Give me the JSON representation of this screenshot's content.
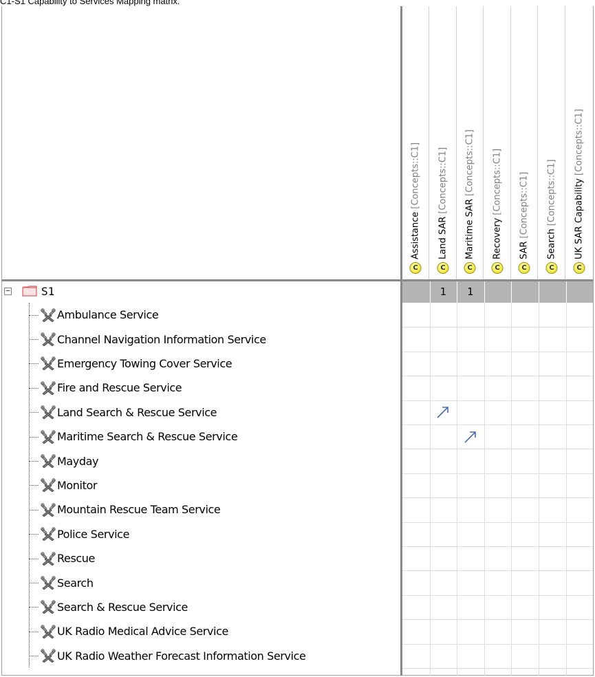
{
  "caption": "C1-S1 Capability to Services Mapping matrix.",
  "columns": [
    {
      "name": "Assistance",
      "tag": "[Concepts::C1]"
    },
    {
      "name": "Land SAR",
      "tag": "[Concepts::C1]"
    },
    {
      "name": "Maritime SAR",
      "tag": "[Concepts::C1]"
    },
    {
      "name": "Recovery",
      "tag": "[Concepts::C1]"
    },
    {
      "name": "SAR",
      "tag": "[Concepts::C1]"
    },
    {
      "name": "Search",
      "tag": "[Concepts::C1]"
    },
    {
      "name": "UK SAR Capability",
      "tag": "[Concepts::C1]"
    }
  ],
  "column_icon_letter": "C",
  "root": {
    "expander": "−",
    "label": "S1",
    "counts": [
      "",
      "1",
      "1",
      "",
      "",
      "",
      ""
    ]
  },
  "services": [
    "Ambulance Service",
    "Channel Navigation Information Service",
    "Emergency Towing Cover Service",
    "Fire and Rescue Service",
    "Land Search & Rescue Service",
    "Maritime Search & Rescue Service",
    "Mayday",
    "Monitor",
    "Mountain Rescue Team Service",
    "Police Service",
    "Rescue",
    "Search",
    "Search & Rescue Service",
    "UK Radio Medical Advice Service",
    "UK Radio Weather Forecast Information Service"
  ],
  "dependencies": [
    {
      "service": "Land Search & Rescue Service",
      "column": "Land SAR"
    },
    {
      "service": "Maritime Search & Rescue Service",
      "column": "Maritime SAR"
    }
  ],
  "colors": {
    "separator": "#8a8a8a",
    "grid": "#dcdcdc",
    "root_row": "#b4b4b4",
    "arrow": "#4a6ab8",
    "package": "#e8585c",
    "capability": "#f0e640"
  },
  "icons": {
    "package": "package-icon",
    "service": "service-tools-icon",
    "capability": "capability-icon",
    "dependency": "dependency-arrow-icon"
  }
}
